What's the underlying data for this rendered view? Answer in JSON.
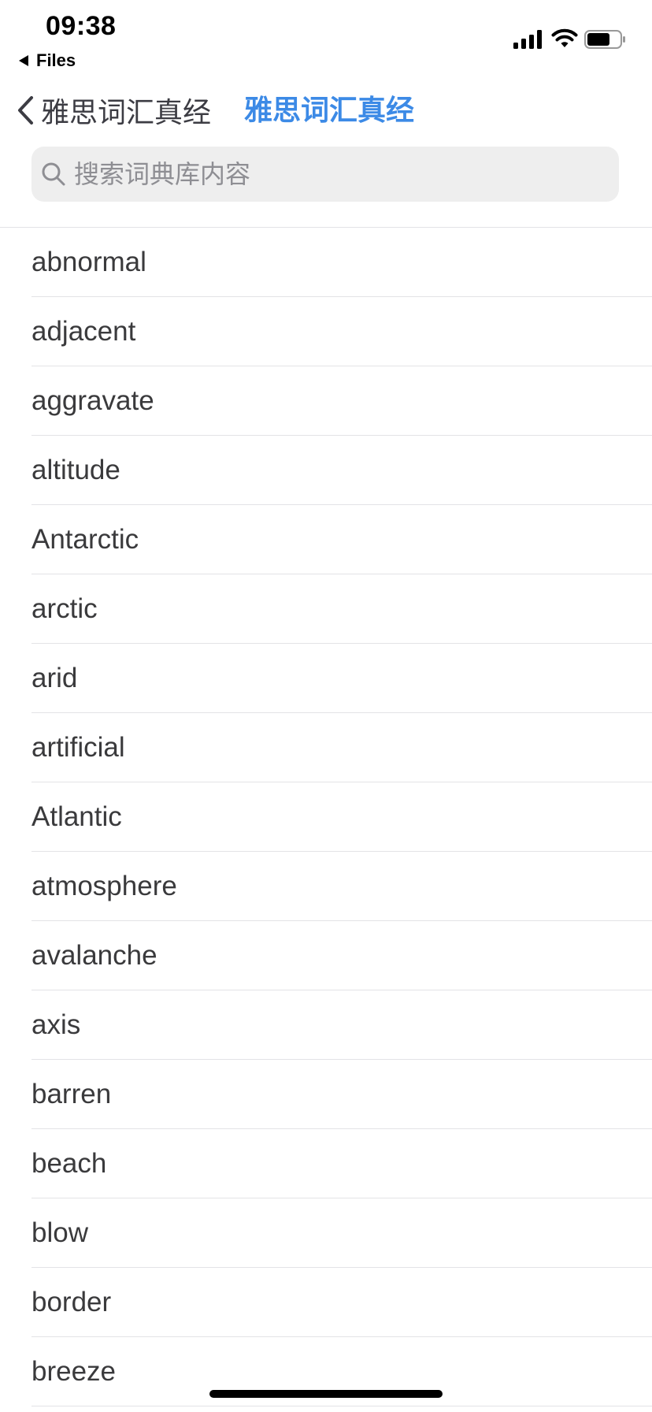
{
  "status_bar": {
    "time": "09:38",
    "back_app_label": "Files"
  },
  "nav": {
    "back_label": "雅思词汇真经",
    "title": "雅思词汇真经"
  },
  "search": {
    "placeholder": "搜索词典库内容",
    "value": ""
  },
  "words": [
    "abnormal",
    "adjacent",
    "aggravate",
    "altitude",
    "Antarctic",
    "arctic",
    "arid",
    "artificial",
    "Atlantic",
    "atmosphere",
    "avalanche",
    "axis",
    "barren",
    "beach",
    "blow",
    "border",
    "breeze"
  ],
  "colors": {
    "accent": "#3c8ae6",
    "text": "#3a3a3c",
    "search_bg": "#eeeeee",
    "divider": "#e3e3e6"
  },
  "icons": {
    "back": "chevron-left-icon",
    "search": "search-icon",
    "signal": "cellular-signal-icon",
    "wifi": "wifi-icon",
    "battery": "battery-icon"
  }
}
